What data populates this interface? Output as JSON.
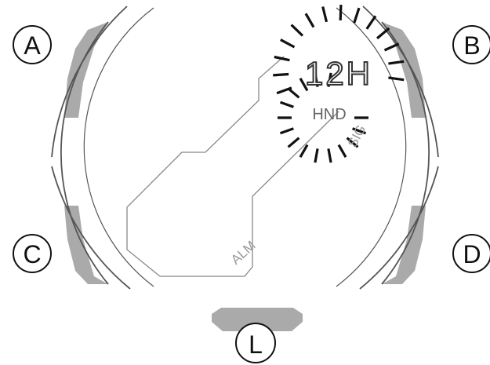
{
  "buttons": {
    "a": "A",
    "b": "B",
    "c": "C",
    "d": "D",
    "l": "L"
  },
  "display": {
    "main_digits": "12H",
    "hand_label": "HND",
    "sig_label": "SIG",
    "alm_label": "ALM"
  },
  "colors": {
    "button_fill": "#aaaaaa",
    "outline": "#555555",
    "ink": "#111111",
    "faint_text": "#999999",
    "background": "#ffffff"
  }
}
